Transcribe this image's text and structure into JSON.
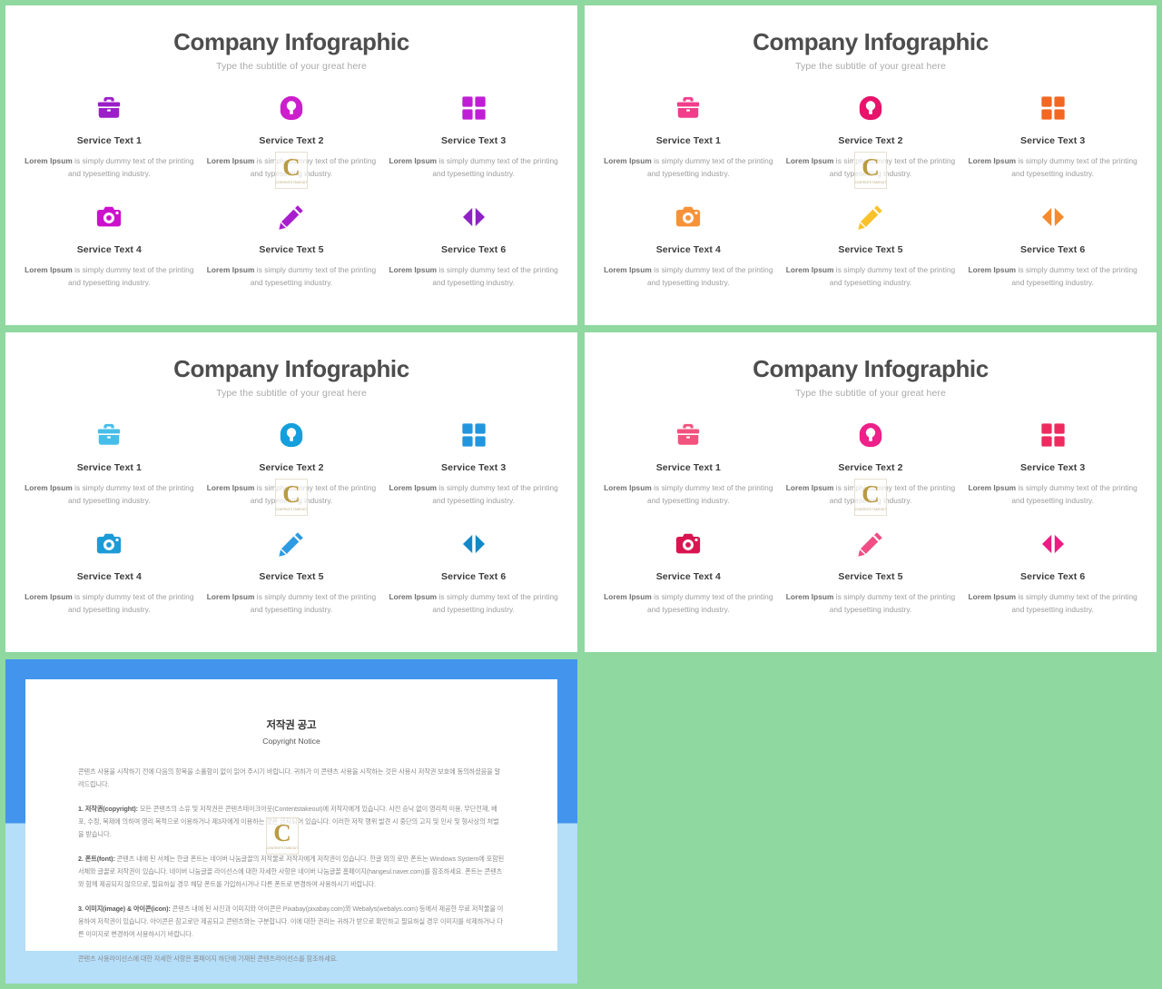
{
  "page": {
    "background_color": "#8FD8A0",
    "watermark": {
      "letter": "C",
      "caption": "CONTENTS TAKEOUT"
    }
  },
  "slides": [
    {
      "id": "slide-1",
      "title": "Company Infographic",
      "subtitle": "Type the subtitle of your great here",
      "theme": "purple",
      "services": [
        {
          "icon": "briefcase-icon",
          "color": "#9B1EC8",
          "name": "Service Text 1",
          "desc_bold": "Lorem Ipsum",
          "desc_rest": " is simply dummy text of the printing and typesetting industry."
        },
        {
          "icon": "headphones-icon",
          "color": "#CC1ECC",
          "name": "Service Text 2",
          "desc_bold": "Lorem Ipsum",
          "desc_rest": " is simply dummy text of the printing and typesetting industry."
        },
        {
          "icon": "grid-icon",
          "color": "#C01ED6",
          "name": "Service Text 3",
          "desc_bold": "Lorem Ipsum",
          "desc_rest": " is simply dummy text of the printing and typesetting industry."
        },
        {
          "icon": "camera-icon",
          "color": "#CC11CC",
          "name": "Service Text 4",
          "desc_bold": "Lorem Ipsum",
          "desc_rest": " is simply dummy text of the printing and typesetting industry."
        },
        {
          "icon": "pencil-icon",
          "color": "#A81ECC",
          "name": "Service Text 5",
          "desc_bold": "Lorem Ipsum",
          "desc_rest": " is simply dummy text of the printing and typesetting industry."
        },
        {
          "icon": "arrows-icon",
          "color": "#8E22C4",
          "name": "Service Text 6",
          "desc_bold": "Lorem Ipsum",
          "desc_rest": " is simply dummy text of the printing and typesetting industry."
        }
      ]
    },
    {
      "id": "slide-2",
      "title": "Company Infographic",
      "subtitle": "Type the subtitle of your great here",
      "theme": "pink-orange",
      "services": [
        {
          "icon": "briefcase-icon",
          "color": "#F23D8B",
          "name": "Service Text 1",
          "desc_bold": "Lorem Ipsum",
          "desc_rest": " is simply dummy text of the printing and typesetting industry."
        },
        {
          "icon": "headphones-icon",
          "color": "#E8136B",
          "name": "Service Text 2",
          "desc_bold": "Lorem Ipsum",
          "desc_rest": " is simply dummy text of the printing and typesetting industry."
        },
        {
          "icon": "grid-icon",
          "color": "#F26722",
          "name": "Service Text 3",
          "desc_bold": "Lorem Ipsum",
          "desc_rest": " is simply dummy text of the printing and typesetting industry."
        },
        {
          "icon": "camera-icon",
          "color": "#F79239",
          "name": "Service Text 4",
          "desc_bold": "Lorem Ipsum",
          "desc_rest": " is simply dummy text of the printing and typesetting industry."
        },
        {
          "icon": "pencil-icon",
          "color": "#F9C22B",
          "name": "Service Text 5",
          "desc_bold": "Lorem Ipsum",
          "desc_rest": " is simply dummy text of the printing and typesetting industry."
        },
        {
          "icon": "arrows-icon",
          "color": "#F58A2E",
          "name": "Service Text 6",
          "desc_bold": "Lorem Ipsum",
          "desc_rest": " is simply dummy text of the printing and typesetting industry."
        }
      ]
    },
    {
      "id": "slide-3",
      "title": "Company Infographic",
      "subtitle": "Type the subtitle of your great here",
      "theme": "blue",
      "services": [
        {
          "icon": "briefcase-icon",
          "color": "#46BEEA",
          "name": "Service Text 1",
          "desc_bold": "Lorem Ipsum",
          "desc_rest": " is simply dummy text of the printing and typesetting industry."
        },
        {
          "icon": "headphones-icon",
          "color": "#149FDC",
          "name": "Service Text 2",
          "desc_bold": "Lorem Ipsum",
          "desc_rest": " is simply dummy text of the printing and typesetting industry."
        },
        {
          "icon": "grid-icon",
          "color": "#2196DE",
          "name": "Service Text 3",
          "desc_bold": "Lorem Ipsum",
          "desc_rest": " is simply dummy text of the printing and typesetting industry."
        },
        {
          "icon": "camera-icon",
          "color": "#1D9BD7",
          "name": "Service Text 4",
          "desc_bold": "Lorem Ipsum",
          "desc_rest": " is simply dummy text of the printing and typesetting industry."
        },
        {
          "icon": "pencil-icon",
          "color": "#2E9BE0",
          "name": "Service Text 5",
          "desc_bold": "Lorem Ipsum",
          "desc_rest": " is simply dummy text of the printing and typesetting industry."
        },
        {
          "icon": "arrows-icon",
          "color": "#1388C9",
          "name": "Service Text 6",
          "desc_bold": "Lorem Ipsum",
          "desc_rest": " is simply dummy text of the printing and typesetting industry."
        }
      ]
    },
    {
      "id": "slide-4",
      "title": "Company Infographic",
      "subtitle": "Type the subtitle of your great here",
      "theme": "rose",
      "services": [
        {
          "icon": "briefcase-icon",
          "color": "#F2527E",
          "name": "Service Text 1",
          "desc_bold": "Lorem Ipsum",
          "desc_rest": " is simply dummy text of the printing and typesetting industry."
        },
        {
          "icon": "headphones-icon",
          "color": "#EE2089",
          "name": "Service Text 2",
          "desc_bold": "Lorem Ipsum",
          "desc_rest": " is simply dummy text of the printing and typesetting industry."
        },
        {
          "icon": "grid-icon",
          "color": "#EE2A5E",
          "name": "Service Text 3",
          "desc_bold": "Lorem Ipsum",
          "desc_rest": " is simply dummy text of the printing and typesetting industry."
        },
        {
          "icon": "camera-icon",
          "color": "#D81551",
          "name": "Service Text 4",
          "desc_bold": "Lorem Ipsum",
          "desc_rest": " is simply dummy text of the printing and typesetting industry."
        },
        {
          "icon": "pencil-icon",
          "color": "#F04E85",
          "name": "Service Text 5",
          "desc_bold": "Lorem Ipsum",
          "desc_rest": " is simply dummy text of the printing and typesetting industry."
        },
        {
          "icon": "arrows-icon",
          "color": "#ED1B83",
          "name": "Service Text 6",
          "desc_bold": "Lorem Ipsum",
          "desc_rest": " is simply dummy text of the printing and typesetting industry."
        }
      ]
    }
  ],
  "copyright_slide": {
    "id": "slide-5",
    "frame_top_color": "#4294EC",
    "frame_bottom_color": "#B5DEF9",
    "title": "저작권 공고",
    "subtitle": "Copyright Notice",
    "paragraphs": [
      {
        "lead": "",
        "text": "콘텐츠 사용을 시작하기 전에 다음의 항목을 소홀함이 없이 읽어 주시기 바랍니다. 귀하가 이 콘텐츠 사용을 시작하는 것은 사용시 저작권 보호에 동의하셨음을 알려드립니다."
      },
      {
        "lead": "1. 저작권(copyright):",
        "text": " 모든 콘텐츠의 소유 및 저작권은 콘텐츠테이크아웃(Contentstakeout)에 저작자에게 있습니다. 사전 승낙 없이 영리적 이용, 무단전재, 배포, 수정, 복제에 의하여 영리 목적으로 이용하거나 제3자에게 이용하는 것은 금지되어 있습니다. 이러한 저작 행위 발견 시 중단의 고지 및 민사 및 형사상의 처벌을 받습니다."
      },
      {
        "lead": "2. 폰트(font):",
        "text": " 콘텐츠 내에 된 서체는 한글 폰트는 네이버 나눔글꼴의 저작물로 저작자에게 저작권이 있습니다. 한글 외의 로만 폰트는 Windows System에 포함된 서체와 글꼴로 저작권이 있습니다. 네이버 나눔글꼴 라이선스에 대한 자세한 사항은 네이버 나눔글꼴 홈페이지(hangeul.naver.com)를 참조하세요. 폰트는 콘텐츠와 함께 제공되지 않으므로, 필요하실 경우 해당 폰트를 가입하시거나 다른 폰트로 변경하여 사용하시기 바랍니다."
      },
      {
        "lead": "3. 이미지(image) & 아이콘(icon):",
        "text": " 콘텐츠 내에 된 사진과 이미지와 아이콘은 Pixabay(pixabay.com)와 Webalys(webalys.com) 등에서 제공한 무료 저작물을 이용하여 저작권이 있습니다. 아이콘은 참고로만 제공되고 콘텐츠와는 구분합니다. 이에 대한 권리는 귀하가 받으로 확인하고 필요하실 경우 이미지를 삭제하거나 다른 이미지로 변경하여 사용하시기 바랍니다."
      },
      {
        "lead": "",
        "text": "콘텐츠 사용라이선스에 대한 자세한 사항은 홈페이지 하단에 기재된 콘텐츠라이선스를 참조하세요."
      }
    ]
  }
}
